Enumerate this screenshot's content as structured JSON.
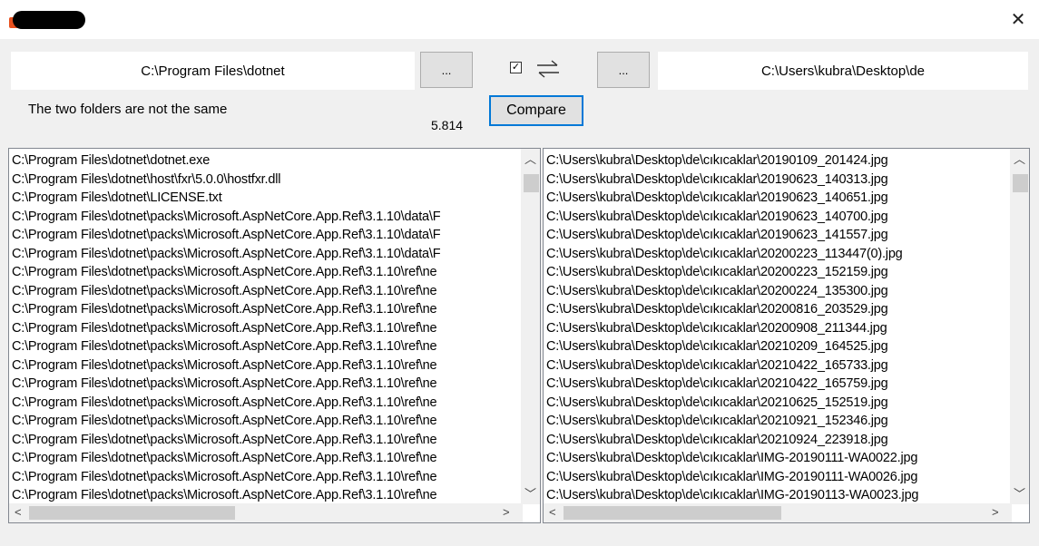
{
  "window": {
    "close_glyph": "✕"
  },
  "toolbar": {
    "left_path": "C:\\Program Files\\dotnet",
    "right_path": "C:\\Users\\kubra\\Desktop\\de",
    "browse_left_label": "...",
    "browse_right_label": "...",
    "checkbox_checked": true,
    "checkbox_glyph": "✓",
    "compare_label": "Compare",
    "status_text": "The two folders are not the same",
    "elapsed": "5.814"
  },
  "left_list": {
    "items": [
      "C:\\Program Files\\dotnet\\dotnet.exe",
      "C:\\Program Files\\dotnet\\host\\fxr\\5.0.0\\hostfxr.dll",
      "C:\\Program Files\\dotnet\\LICENSE.txt",
      "C:\\Program Files\\dotnet\\packs\\Microsoft.AspNetCore.App.Ref\\3.1.10\\data\\F",
      "C:\\Program Files\\dotnet\\packs\\Microsoft.AspNetCore.App.Ref\\3.1.10\\data\\F",
      "C:\\Program Files\\dotnet\\packs\\Microsoft.AspNetCore.App.Ref\\3.1.10\\data\\F",
      "C:\\Program Files\\dotnet\\packs\\Microsoft.AspNetCore.App.Ref\\3.1.10\\ref\\ne",
      "C:\\Program Files\\dotnet\\packs\\Microsoft.AspNetCore.App.Ref\\3.1.10\\ref\\ne",
      "C:\\Program Files\\dotnet\\packs\\Microsoft.AspNetCore.App.Ref\\3.1.10\\ref\\ne",
      "C:\\Program Files\\dotnet\\packs\\Microsoft.AspNetCore.App.Ref\\3.1.10\\ref\\ne",
      "C:\\Program Files\\dotnet\\packs\\Microsoft.AspNetCore.App.Ref\\3.1.10\\ref\\ne",
      "C:\\Program Files\\dotnet\\packs\\Microsoft.AspNetCore.App.Ref\\3.1.10\\ref\\ne",
      "C:\\Program Files\\dotnet\\packs\\Microsoft.AspNetCore.App.Ref\\3.1.10\\ref\\ne",
      "C:\\Program Files\\dotnet\\packs\\Microsoft.AspNetCore.App.Ref\\3.1.10\\ref\\ne",
      "C:\\Program Files\\dotnet\\packs\\Microsoft.AspNetCore.App.Ref\\3.1.10\\ref\\ne",
      "C:\\Program Files\\dotnet\\packs\\Microsoft.AspNetCore.App.Ref\\3.1.10\\ref\\ne",
      "C:\\Program Files\\dotnet\\packs\\Microsoft.AspNetCore.App.Ref\\3.1.10\\ref\\ne",
      "C:\\Program Files\\dotnet\\packs\\Microsoft.AspNetCore.App.Ref\\3.1.10\\ref\\ne",
      "C:\\Program Files\\dotnet\\packs\\Microsoft.AspNetCore.App.Ref\\3.1.10\\ref\\ne"
    ]
  },
  "right_list": {
    "items": [
      "C:\\Users\\kubra\\Desktop\\de\\cıkıcaklar\\20190109_201424.jpg",
      "C:\\Users\\kubra\\Desktop\\de\\cıkıcaklar\\20190623_140313.jpg",
      "C:\\Users\\kubra\\Desktop\\de\\cıkıcaklar\\20190623_140651.jpg",
      "C:\\Users\\kubra\\Desktop\\de\\cıkıcaklar\\20190623_140700.jpg",
      "C:\\Users\\kubra\\Desktop\\de\\cıkıcaklar\\20190623_141557.jpg",
      "C:\\Users\\kubra\\Desktop\\de\\cıkıcaklar\\20200223_113447(0).jpg",
      "C:\\Users\\kubra\\Desktop\\de\\cıkıcaklar\\20200223_152159.jpg",
      "C:\\Users\\kubra\\Desktop\\de\\cıkıcaklar\\20200224_135300.jpg",
      "C:\\Users\\kubra\\Desktop\\de\\cıkıcaklar\\20200816_203529.jpg",
      "C:\\Users\\kubra\\Desktop\\de\\cıkıcaklar\\20200908_211344.jpg",
      "C:\\Users\\kubra\\Desktop\\de\\cıkıcaklar\\20210209_164525.jpg",
      "C:\\Users\\kubra\\Desktop\\de\\cıkıcaklar\\20210422_165733.jpg",
      "C:\\Users\\kubra\\Desktop\\de\\cıkıcaklar\\20210422_165759.jpg",
      "C:\\Users\\kubra\\Desktop\\de\\cıkıcaklar\\20210625_152519.jpg",
      "C:\\Users\\kubra\\Desktop\\de\\cıkıcaklar\\20210921_152346.jpg",
      "C:\\Users\\kubra\\Desktop\\de\\cıkıcaklar\\20210924_223918.jpg",
      "C:\\Users\\kubra\\Desktop\\de\\cıkıcaklar\\IMG-20190111-WA0022.jpg",
      "C:\\Users\\kubra\\Desktop\\de\\cıkıcaklar\\IMG-20190111-WA0026.jpg",
      "C:\\Users\\kubra\\Desktop\\de\\cıkıcaklar\\IMG-20190113-WA0023.jpg"
    ]
  },
  "icons": {
    "scroll_up": "︿",
    "scroll_down": "﹀",
    "scroll_left": "<",
    "scroll_right": ">"
  }
}
